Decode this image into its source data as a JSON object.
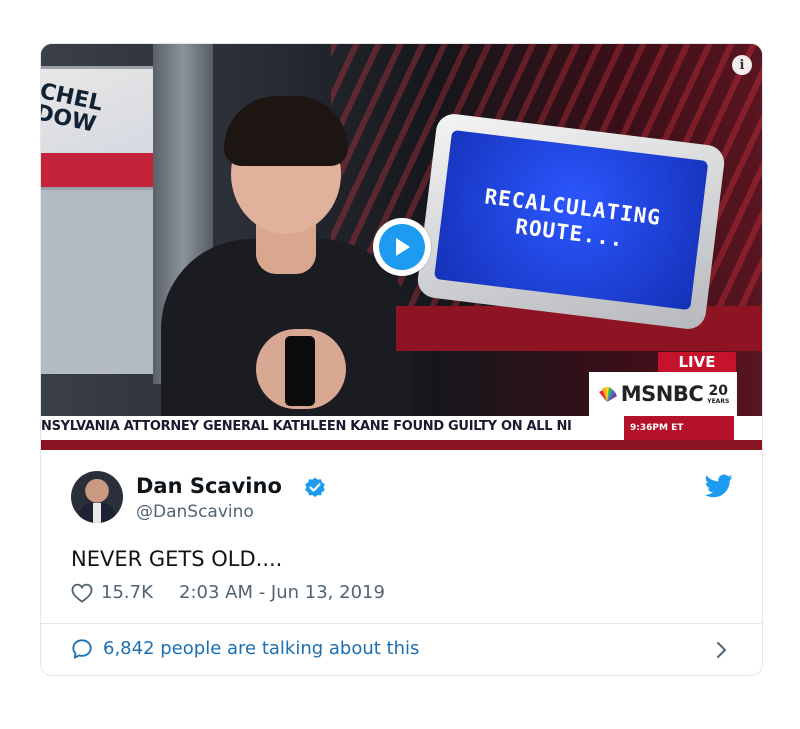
{
  "video": {
    "left_monitor_text": "CHEL\nDOW",
    "screen_text_line1": "RECALCULATING",
    "screen_text_line2": "ROUTE...",
    "live_label": "LIVE",
    "network_logo": "MSNBC",
    "anniversary_number": "20",
    "anniversary_word": "YEARS",
    "ticker_text": "NSYLVANIA ATTORNEY GENERAL KATHLEEN KANE FOUND GUILTY ON ALL NI",
    "ticker_time": "9:36PM ET"
  },
  "tweet": {
    "author_name": "Dan Scavino",
    "author_handle": "@DanScavino",
    "text": "NEVER GETS OLD....",
    "like_count": "15.7K",
    "timestamp": "2:03 AM - Jun 13, 2019",
    "talking_text": "6,842 people are talking about this"
  },
  "colors": {
    "twitter_blue": "#1d9bf0",
    "link_blue": "#1b6fb3",
    "secondary_text": "#536471",
    "msnbc_red": "#c5132b"
  },
  "icons": {
    "play": "play-icon",
    "info": "info-icon",
    "verified": "verified-badge-icon",
    "bird": "twitter-bird-icon",
    "like": "heart-icon",
    "reply": "speech-bubble-icon",
    "chevron": "chevron-right-icon"
  }
}
